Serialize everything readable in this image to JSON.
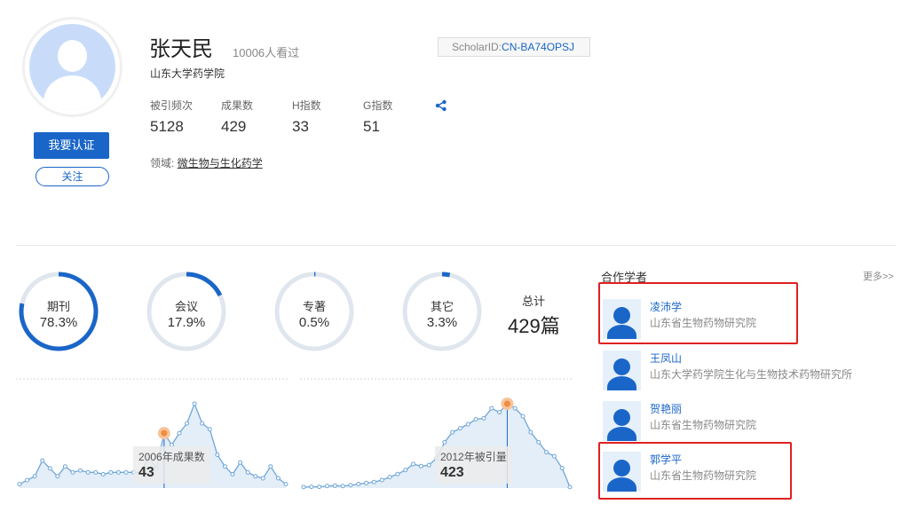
{
  "profile": {
    "name": "张天民",
    "views": "10006人看过",
    "scholar_id_label": "ScholarID:",
    "scholar_id_value": "CN-BA74OPSJ",
    "affiliation": "山东大学药学院",
    "claim_label": "我要认证",
    "follow_label": "关注",
    "field_label": "领域:",
    "field_value": "微生物与生化药学",
    "stats": [
      {
        "label": "被引频次",
        "value": "5128"
      },
      {
        "label": "成果数",
        "value": "429"
      },
      {
        "label": "H指数",
        "value": "33"
      },
      {
        "label": "G指数",
        "value": "51"
      }
    ],
    "share_icon": "share-icon"
  },
  "distribution": {
    "items": [
      {
        "label": "期刊",
        "value": "78.3%",
        "fraction": 0.783
      },
      {
        "label": "会议",
        "value": "17.9%",
        "fraction": 0.179
      },
      {
        "label": "专著",
        "value": "0.5%",
        "fraction": 0.005
      },
      {
        "label": "其它",
        "value": "3.3%",
        "fraction": 0.033
      }
    ],
    "total_label": "总计",
    "total_value": "429篇"
  },
  "chart_data": [
    {
      "type": "area",
      "tooltip_label": "2006年成果数",
      "tooltip_value": "43",
      "highlight_index": 19,
      "values": [
        2,
        4,
        6,
        14,
        10,
        6,
        11,
        8,
        9,
        8,
        8,
        7,
        8,
        8,
        8,
        8,
        8,
        16,
        10,
        28,
        22,
        28,
        33,
        43,
        33,
        30,
        17,
        11,
        7,
        13,
        8,
        6,
        5,
        11,
        5,
        2
      ]
    },
    {
      "type": "area",
      "tooltip_label": "2012年被引量",
      "tooltip_value": "423",
      "highlight_index": 26,
      "values": [
        5,
        6,
        6,
        10,
        12,
        10,
        14,
        20,
        25,
        30,
        40,
        55,
        70,
        90,
        120,
        110,
        115,
        150,
        230,
        280,
        300,
        320,
        345,
        350,
        400,
        380,
        423,
        400,
        360,
        280,
        230,
        180,
        160,
        100,
        5
      ]
    }
  ],
  "coauthors": {
    "title": "合作学者",
    "more_label": "更多>>",
    "items": [
      {
        "name": "凌沛学",
        "affiliation": "山东省生物药物研究院"
      },
      {
        "name": "王凤山",
        "affiliation": "山东大学药学院生化与生物技术药物研究所"
      },
      {
        "name": "贺艳丽",
        "affiliation": "山东省生物药物研究院"
      },
      {
        "name": "郭学平",
        "affiliation": "山东省生物药物研究院"
      }
    ]
  },
  "colors": {
    "accent": "#1a66c8",
    "ring_bg": "#dfe6ee",
    "highlight_box": "#e02020",
    "chart_line": "#6fa6d8",
    "chart_point_active": "#f08c3c"
  }
}
